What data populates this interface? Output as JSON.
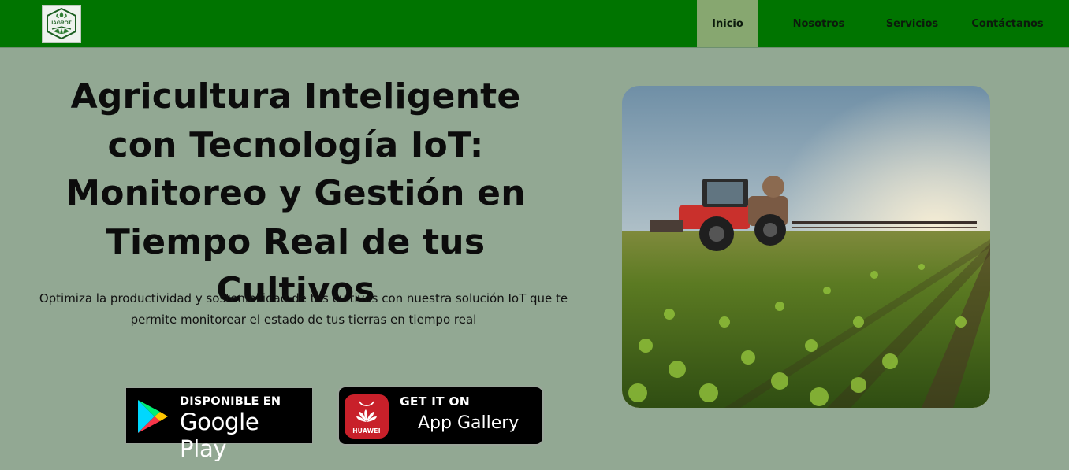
{
  "brand": {
    "logo_text": "IAGROT",
    "logo_icon": "agro-leaf-logo-icon"
  },
  "nav": {
    "items": [
      {
        "label": "Inicio",
        "active": true
      },
      {
        "label": "Nosotros",
        "active": false
      },
      {
        "label": "Servicios",
        "active": false
      },
      {
        "label": "Contáctanos",
        "active": false
      }
    ]
  },
  "hero": {
    "title": "Agricultura Inteligente con Tecnología IoT: Monitoreo y Gestión en Tiempo Real de tus Cultivos",
    "subtitle": "Optimiza la productividad y sostenibilidad de tus cultivos con nuestra solución IoT que te permite monitorear el estado de tus tierras en tiempo real",
    "image_icon": "tractor-field-photo"
  },
  "badges": {
    "google": {
      "small": "DISPONIBLE EN",
      "big": "Google Play",
      "icon": "google-play-icon"
    },
    "huawei": {
      "small": "GET IT ON",
      "big": "App Gallery",
      "icon_label": "HUAWEI",
      "icon": "huawei-icon"
    }
  },
  "colors": {
    "header_bg": "#007400",
    "nav_active_bg": "#87a770",
    "page_bg": "#92a893",
    "huawei_red": "#c8202a"
  }
}
